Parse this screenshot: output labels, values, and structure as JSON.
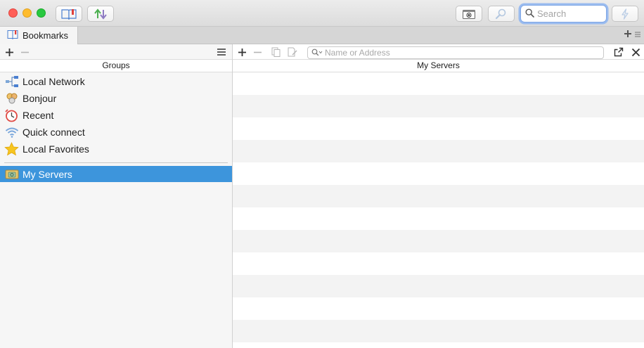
{
  "window": {
    "search_placeholder": "Search"
  },
  "tabs": [
    {
      "label": "Bookmarks",
      "icon": "bookmark-book-icon"
    }
  ],
  "left_pane": {
    "column_header": "Groups",
    "groups": [
      {
        "label": "Local Network",
        "icon": "network-icon"
      },
      {
        "label": "Bonjour",
        "icon": "bonjour-icon"
      },
      {
        "label": "Recent",
        "icon": "recent-clock-icon"
      },
      {
        "label": "Quick connect",
        "icon": "wifi-icon"
      },
      {
        "label": "Local Favorites",
        "icon": "star-icon"
      }
    ],
    "selected_group": {
      "label": "My Servers",
      "icon": "server-folder-icon"
    }
  },
  "right_pane": {
    "address_placeholder": "Name or Address",
    "column_header": "My Servers",
    "row_count": 12
  },
  "colors": {
    "selection": "#3d95dc",
    "search_focus": "#9bbcef",
    "close": "#ff5f57",
    "minimize": "#febc2e",
    "maximize": "#28c840"
  }
}
